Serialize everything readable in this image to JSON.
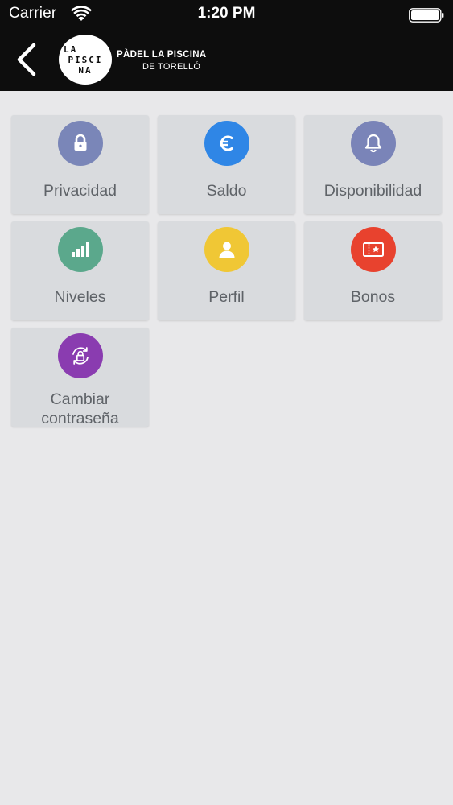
{
  "status_bar": {
    "carrier": "Carrier",
    "time": "1:20 PM"
  },
  "header": {
    "logo_lines": [
      "LA",
      "PISCI",
      "NA"
    ],
    "brand_name": "PÀDEL LA PISCINA",
    "brand_subtitle": "DE TORELLÓ"
  },
  "colors": {
    "header_bg": "#0d0d0d",
    "page_bg": "#e8e8ea",
    "tile_bg": "#d9dbde",
    "privacidad": "#7a86b8",
    "saldo": "#2f86e6",
    "disponibilidad": "#7a84b8",
    "niveles": "#5ba88c",
    "perfil": "#f0c735",
    "bonos": "#e8422e",
    "cambiar": "#8a3cb0"
  },
  "tiles": [
    {
      "label": "Privacidad",
      "icon": "lock-icon"
    },
    {
      "label": "Saldo",
      "icon": "euro-icon"
    },
    {
      "label": "Disponibilidad",
      "icon": "bell-icon"
    },
    {
      "label": "Niveles",
      "icon": "signal-bars-icon"
    },
    {
      "label": "Perfil",
      "icon": "user-icon"
    },
    {
      "label": "Bonos",
      "icon": "ticket-icon"
    },
    {
      "label_line1": "Cambiar",
      "label_line2": "contraseña",
      "icon": "lock-refresh-icon"
    }
  ]
}
